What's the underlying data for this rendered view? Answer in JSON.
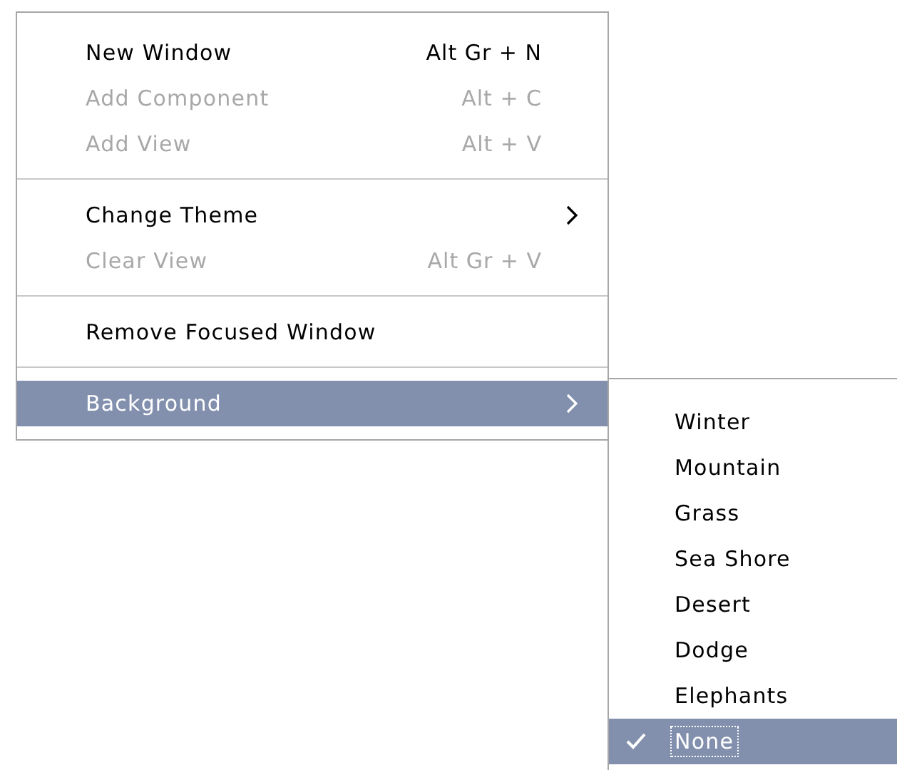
{
  "menu": {
    "items": [
      {
        "kind": "item",
        "label": "New Window",
        "shortcut": "Alt Gr + N",
        "disabled": false,
        "submenu": false,
        "selected": false
      },
      {
        "kind": "item",
        "label": "Add Component",
        "shortcut": "Alt + C",
        "disabled": true,
        "submenu": false,
        "selected": false
      },
      {
        "kind": "item",
        "label": "Add View",
        "shortcut": "Alt + V",
        "disabled": true,
        "submenu": false,
        "selected": false
      },
      {
        "kind": "separator"
      },
      {
        "kind": "item",
        "label": "Change Theme",
        "disabled": false,
        "submenu": true,
        "selected": false
      },
      {
        "kind": "item",
        "label": "Clear View",
        "shortcut": "Alt Gr + V",
        "disabled": true,
        "submenu": false,
        "selected": false
      },
      {
        "kind": "separator"
      },
      {
        "kind": "item",
        "label": "Remove Focused Window",
        "disabled": false,
        "submenu": false,
        "selected": false
      },
      {
        "kind": "separator"
      },
      {
        "kind": "item",
        "label": "Background",
        "disabled": false,
        "submenu": true,
        "selected": true
      }
    ]
  },
  "submenu": {
    "items": [
      {
        "label": "Winter",
        "checked": false,
        "selected": false
      },
      {
        "label": "Mountain",
        "checked": false,
        "selected": false
      },
      {
        "label": "Grass",
        "checked": false,
        "selected": false
      },
      {
        "label": "Sea Shore",
        "checked": false,
        "selected": false
      },
      {
        "label": "Desert",
        "checked": false,
        "selected": false
      },
      {
        "label": "Dodge",
        "checked": false,
        "selected": false
      },
      {
        "label": "Elephants",
        "checked": false,
        "selected": false
      },
      {
        "label": "None",
        "checked": true,
        "selected": true
      }
    ]
  }
}
